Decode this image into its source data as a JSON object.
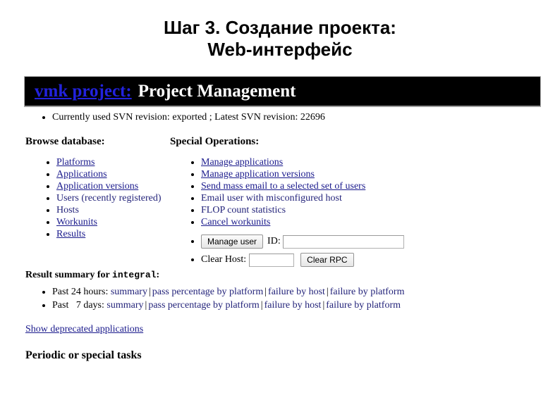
{
  "slide": {
    "title_line1": "Шаг 3. Создание проекта:",
    "title_line2": "Web-интерфейс"
  },
  "colors": {
    "header_background": "#000000",
    "header_link": "#2222dd",
    "header_title": "#ffffff",
    "link": "#1a1a8c",
    "plain_link": "#23237a",
    "page_background": "#ffffff"
  },
  "site_header": {
    "project_link": "vmk project:",
    "page_title": "Project Management"
  },
  "revision": {
    "text": "Currently used SVN revision: exported ; Latest SVN revision: 22696",
    "current_revision": "exported",
    "latest_revision": "22696"
  },
  "browse_database": {
    "heading": "Browse database:",
    "items": [
      {
        "label": "Platforms",
        "is_link": true
      },
      {
        "label": "Applications",
        "is_link": true
      },
      {
        "label": "Application versions",
        "is_link": true
      },
      {
        "label": "Users (recently registered)",
        "is_link": false
      },
      {
        "label": "Hosts",
        "is_link": false
      },
      {
        "label": "Workunits",
        "is_link": true
      },
      {
        "label": "Results",
        "is_link": true
      }
    ]
  },
  "special_operations": {
    "heading": "Special Operations:",
    "items": [
      {
        "label": "Manage applications",
        "is_link": true
      },
      {
        "label": "Manage application versions",
        "is_link": true
      },
      {
        "label": "Send mass email to a selected set of users",
        "is_link": true
      },
      {
        "label": "Email user with misconfigured host",
        "is_link": false
      },
      {
        "label": "FLOP count statistics",
        "is_link": false
      },
      {
        "label": "Cancel workunits",
        "is_link": true
      }
    ],
    "manage_user": {
      "button_label": "Manage user",
      "id_label": "ID:",
      "id_value": "",
      "id_placeholder": ""
    },
    "clear_host": {
      "label": "Clear Host:",
      "value": "",
      "placeholder": "",
      "button_label": "Clear RPC"
    }
  },
  "result_summary": {
    "heading_prefix": "Result summary for ",
    "heading_app": "integral",
    "heading_suffix": ":",
    "rows": [
      {
        "period": "Past 24 hours:",
        "links": [
          "summary",
          "pass percentage by platform",
          "failure by host",
          "failure by platform"
        ]
      },
      {
        "period": "Past   7 days:",
        "links": [
          "summary",
          "pass percentage by platform",
          "failure by host",
          "failure by platform"
        ]
      }
    ],
    "separator": "|"
  },
  "footer": {
    "deprecated_link": "Show deprecated applications",
    "periodic_heading": "Periodic or special tasks"
  }
}
